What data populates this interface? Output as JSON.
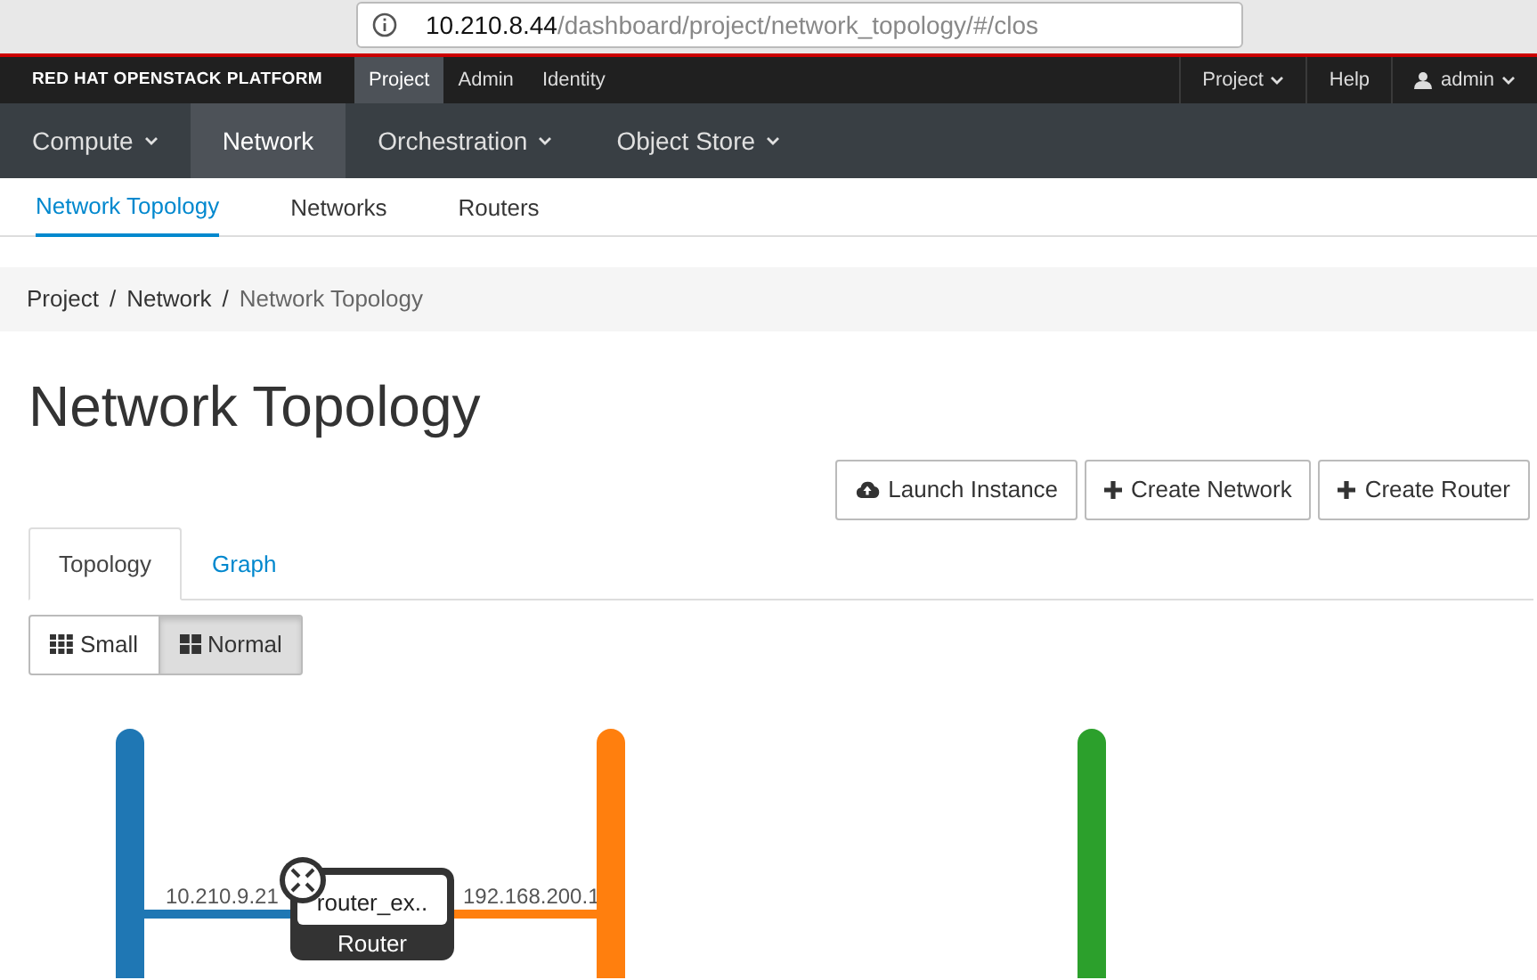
{
  "browser": {
    "url_host": "10.210.8.44",
    "url_path": "/dashboard/project/network_topology/#/clos"
  },
  "brand": "RED HAT OPENSTACK PLATFORM",
  "top_tabs": [
    {
      "label": "Project",
      "selected": true
    },
    {
      "label": "Admin",
      "selected": false
    },
    {
      "label": "Identity",
      "selected": false
    }
  ],
  "top_right": [
    {
      "label": "Project",
      "kind": "dropdown"
    },
    {
      "label": "Help",
      "kind": "link"
    },
    {
      "label": "admin",
      "kind": "user"
    }
  ],
  "main_nav": [
    {
      "label": "Compute",
      "dropdown": true,
      "selected": false
    },
    {
      "label": "Network",
      "dropdown": false,
      "selected": true
    },
    {
      "label": "Orchestration",
      "dropdown": true,
      "selected": false
    },
    {
      "label": "Object Store",
      "dropdown": true,
      "selected": false
    }
  ],
  "sub_nav": [
    {
      "label": "Network Topology",
      "selected": true
    },
    {
      "label": "Networks",
      "selected": false
    },
    {
      "label": "Routers",
      "selected": false
    }
  ],
  "breadcrumb": [
    {
      "label": "Project",
      "separator": "/"
    },
    {
      "label": "Network",
      "separator": "/"
    },
    {
      "label": "Network Topology"
    }
  ],
  "page_title": "Network Topology",
  "actions": [
    {
      "label": "Launch Instance",
      "kind": "cloud"
    },
    {
      "label": "Create Network",
      "kind": "plus"
    },
    {
      "label": "Create Router",
      "kind": "plus"
    }
  ],
  "view_tabs": [
    {
      "label": "Topology",
      "selected": true
    },
    {
      "label": "Graph",
      "selected": false
    }
  ],
  "size_toggle": [
    {
      "label": "Small",
      "kind": "small",
      "selected": false
    },
    {
      "label": "Normal",
      "kind": "normal",
      "selected": true
    }
  ],
  "topology": {
    "networks": [
      {
        "color": "#1f77b4"
      },
      {
        "color": "#ff7f0e"
      },
      {
        "color": "#2ca02c"
      }
    ],
    "router": {
      "name": "router_ex..",
      "type_label": "Router"
    },
    "links": [
      {
        "ip": "10.210.9.21"
      },
      {
        "ip": "192.168.200.1"
      }
    ]
  }
}
